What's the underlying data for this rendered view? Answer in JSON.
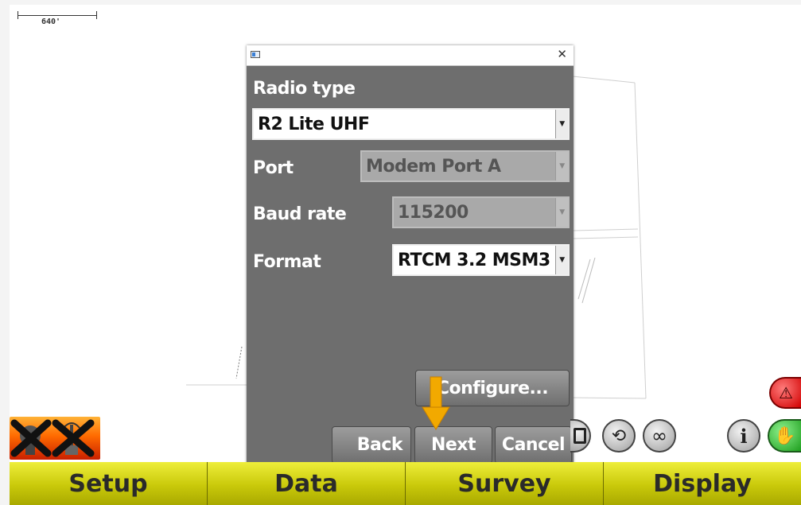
{
  "map": {
    "scale_label": "640'"
  },
  "dialog": {
    "radio_type_label": "Radio type",
    "radio_type_value": "R2 Lite UHF",
    "port_label": "Port",
    "port_value": "Modem Port A",
    "baud_label": "Baud rate",
    "baud_value": "115200",
    "format_label": "Format",
    "format_value": "RTCM 3.2 MSM3",
    "configure_label": "Configure...",
    "back_label": "Back",
    "next_label": "Next",
    "cancel_label": "Cancel"
  },
  "tabs": [
    "Setup",
    "Data",
    "Survey",
    "Display"
  ],
  "colors": {
    "tab_yellow": "#c9c90a",
    "dialog_gray": "#6e6e6e",
    "indicator_orange": "#f2a900"
  },
  "icons": [
    "window-icon",
    "close-icon",
    "no-gnss-icon",
    "no-radio-icon",
    "square-icon",
    "rotate-icon",
    "infinity-icon",
    "info-icon",
    "hand-icon",
    "alert-icon",
    "arrow-down-icon"
  ]
}
